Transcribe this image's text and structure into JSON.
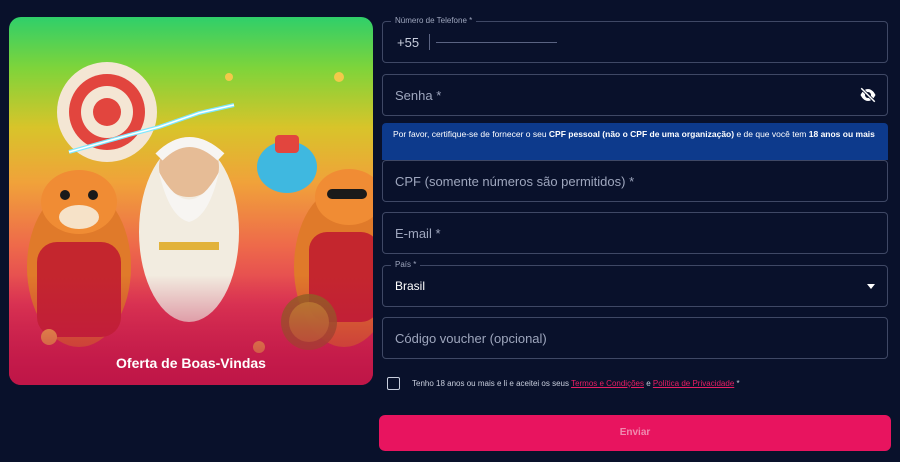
{
  "promo": {
    "title": "Oferta de Boas-Vindas"
  },
  "form": {
    "phone": {
      "label": "Número de Telefone *",
      "prefix": "+55"
    },
    "password": {
      "placeholder": "Senha *",
      "icon": "eye-off-icon"
    },
    "notice": {
      "part1": "Por favor, certifique-se de fornecer o seu ",
      "bold1": "CPF pessoal (não o CPF de uma organização)",
      "part2": " e de que você tem ",
      "bold2": "18 anos ou mais"
    },
    "cpf": {
      "placeholder": "CPF (somente números são permitidos) *"
    },
    "email": {
      "placeholder": "E-mail *"
    },
    "country": {
      "label": "País *",
      "value": "Brasil"
    },
    "voucher": {
      "placeholder": "Código voucher (opcional)"
    },
    "terms": {
      "text1": "Tenho 18 anos ou mais e li e aceitei os seus ",
      "link1": "Termos e Condições",
      "text2": " e ",
      "link2": "Política de Privacidade",
      "text3": " *"
    },
    "submit_label": "Enviar"
  },
  "colors": {
    "background": "#09112b",
    "accent": "#e8145f",
    "notice_bg": "#0d3a8c",
    "field_border": "#3f4865"
  }
}
